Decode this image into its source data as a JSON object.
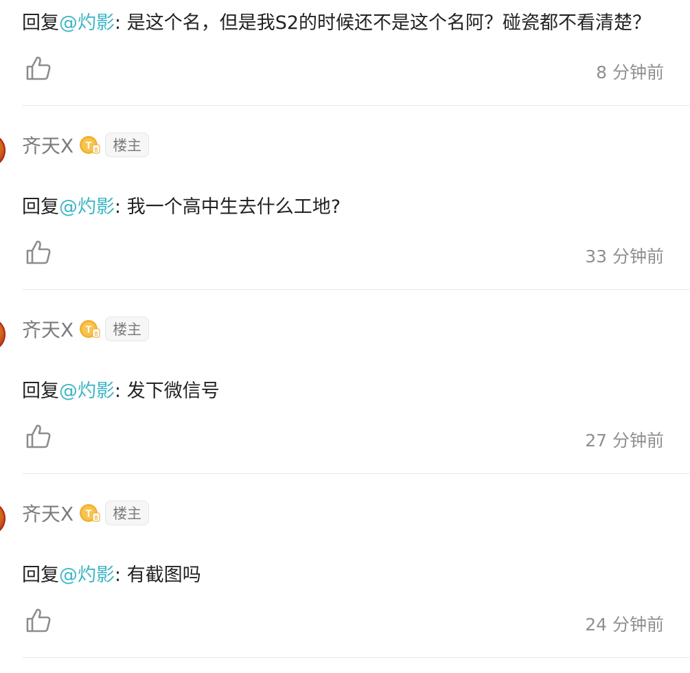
{
  "reply_prefix": "回复",
  "replies": [
    {
      "username": "",
      "op_tag": "",
      "mention": "@灼影",
      "separator": ":",
      "text": "是这个名，但是我S2的时候还不是这个名阿？碰瓷都不看清楚？",
      "time": "8 分钟前"
    },
    {
      "username": "齐天X",
      "op_tag": "楼主",
      "mention": "@灼影",
      "separator": ":",
      "text": "我一个高中生去什么工地?",
      "time": "33 分钟前"
    },
    {
      "username": "齐天X",
      "op_tag": "楼主",
      "mention": "@灼影",
      "separator": ":",
      "text": "发下微信号",
      "time": "27 分钟前"
    },
    {
      "username": "齐天X",
      "op_tag": "楼主",
      "mention": "@灼影",
      "separator": ":",
      "text": "有截图吗",
      "time": "24 分钟前"
    }
  ],
  "icons": {
    "like": "thumbs-up-icon",
    "level": "level-badge-icon"
  },
  "colors": {
    "mention": "#3fb6c6",
    "username": "#7b7b7b",
    "text": "#222222",
    "time": "#8f8f8f",
    "badge": "#f2b230"
  }
}
